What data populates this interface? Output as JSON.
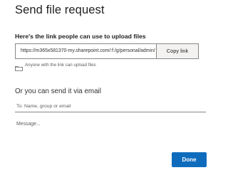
{
  "dialog": {
    "title": "Send file request"
  },
  "link_section": {
    "heading": "Here's the link people can use to upload files",
    "url": "https://m365x581370-my.sharepoint.com/:f:/g/personal/admin/",
    "copy_label": "Copy link",
    "permission_text": "Anyone with the link can upload files",
    "permission_icon": "folder-share-icon"
  },
  "email_section": {
    "heading": "Or you can send it via email",
    "to_placeholder": "To: Name, group or email",
    "message_placeholder": "Message..."
  },
  "footer": {
    "done_label": "Done",
    "accent_color": "#0f6cbd"
  }
}
